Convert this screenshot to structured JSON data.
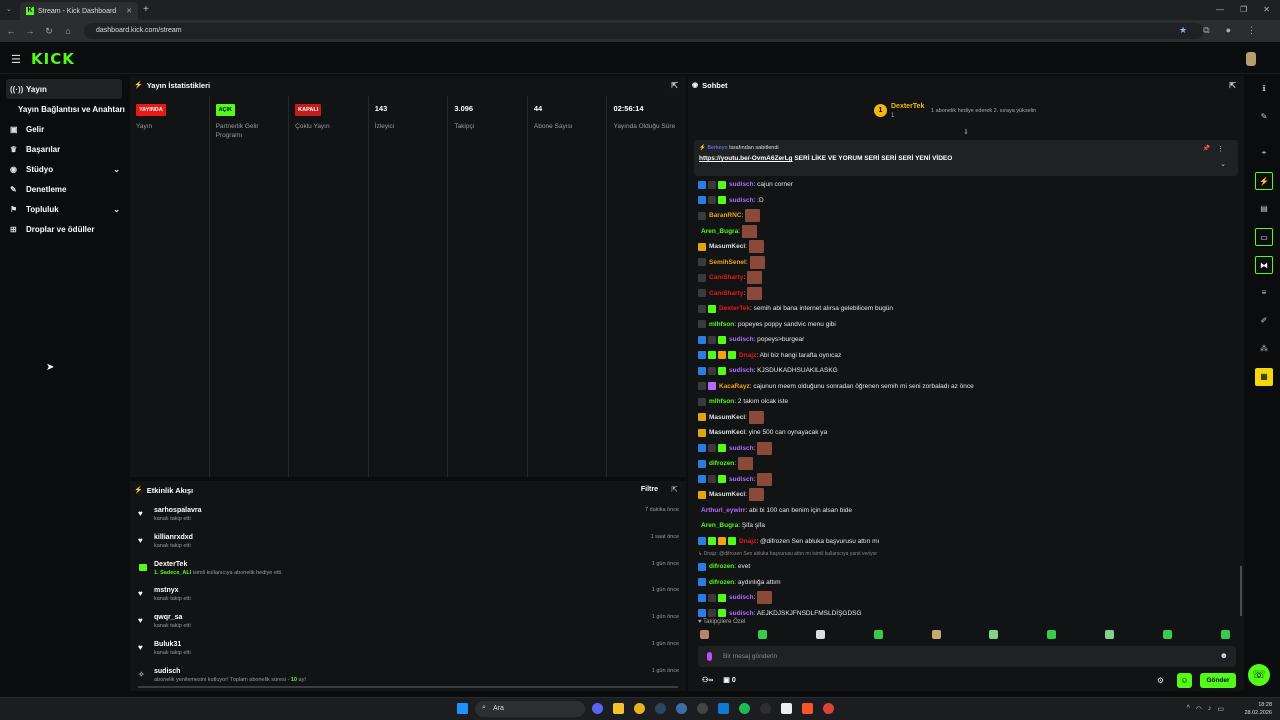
{
  "browser": {
    "tab_title": "Stream - Kick Dashboard",
    "url": "dashboard.kick.com/stream"
  },
  "brand": {
    "logo": "KICK",
    "accent": "#53fc18"
  },
  "sidebar": {
    "items": [
      {
        "label": "Yayın",
        "icon": "broadcast-icon",
        "active": true
      },
      {
        "label": "Yayın Bağlantısı ve Anahtarı",
        "sub": true
      },
      {
        "label": "Gelir",
        "icon": "wallet-icon"
      },
      {
        "label": "Başarılar",
        "icon": "trophy-icon"
      },
      {
        "label": "Stüdyo",
        "icon": "studio-icon",
        "chevron": true
      },
      {
        "label": "Denetleme",
        "icon": "wrench-icon"
      },
      {
        "label": "Topluluk",
        "icon": "community-icon",
        "chevron": true
      },
      {
        "label": "Droplar ve ödüller",
        "icon": "gift-icon"
      }
    ]
  },
  "stats": {
    "title": "Yayın İstatistikleri",
    "cols": [
      {
        "value": "YAYINDA",
        "label": "Yayın",
        "badge": "red"
      },
      {
        "value": "AÇIK",
        "label": "Partnerlik Gelir Programı",
        "badge": "green"
      },
      {
        "value": "KAPALI",
        "label": "Çoklu Yayın",
        "badge": "redd"
      },
      {
        "value": "143",
        "label": "İzleyici"
      },
      {
        "value": "3.096",
        "label": "Takipçi"
      },
      {
        "value": "44",
        "label": "Abone Sayısı"
      },
      {
        "value": "02:56:14",
        "label": "Yayında Olduğu Süre"
      }
    ]
  },
  "activity": {
    "title": "Etkinlik Akışı",
    "filter": "Filtre",
    "items": [
      {
        "name": "sarhospalavra",
        "desc": "kanalı takip etti",
        "time": "7 dakika önce",
        "icon": "heart-icon"
      },
      {
        "name": "killianrxdxd",
        "desc": "kanalı takip etti",
        "time": "1 saat önce",
        "icon": "heart-icon"
      },
      {
        "name": "DexterTek",
        "desc_highlight": "1. Sadece_ALI",
        "desc": " isimli kullanıcıya abonelik hediye etti.",
        "time": "1 gün önce",
        "icon": "gift-sub-icon"
      },
      {
        "name": "mstnyx",
        "desc": "kanalı takip etti",
        "time": "1 gün önce",
        "icon": "heart-icon"
      },
      {
        "name": "qwqr_sa",
        "desc": "kanalı takip etti",
        "time": "1 gün önce",
        "icon": "heart-icon"
      },
      {
        "name": "Buluk31",
        "desc": "kanalı takip etti",
        "time": "1 gün önce",
        "icon": "heart-icon"
      },
      {
        "name": "sudisch",
        "desc": "abonelik yenilemesini kutluyor! Toplam abonelik süresi - ",
        "desc_highlight2": "10",
        "desc_end": " ay!",
        "time": "1 gün önce",
        "icon": "sparkle-icon"
      }
    ]
  },
  "chat": {
    "title": "Sohbet",
    "gift_rank": "1",
    "gift_user": "DexterTek",
    "gift_count": "1",
    "gift_msg": "1 abonelik hediye ederek 2. sıraya yükselin",
    "pinned_by_user": "Berkeyo",
    "pinned_by_text": " tarafından sabitlendi",
    "pinned_link": "https://youtu.be/-OvmA6ZerLg",
    "pinned_text": " SERİ LİKE VE YORUM SERİ SERİ SERİ YENİ VİDEO",
    "messages": [
      {
        "user": "sudisch",
        "color": "#b36cff",
        "text": ": cajun corner",
        "icons": [
          "#2a7de1",
          "#3a3a3a",
          "#53fc18"
        ]
      },
      {
        "user": "sudisch",
        "color": "#b36cff",
        "text": ": :D",
        "icons": [
          "#2a7de1",
          "#3a3a3a",
          "#53fc18"
        ]
      },
      {
        "user": "BaranRNC",
        "color": "#f2a20c",
        "text": ":",
        "icons": [
          "#3a3a3a"
        ],
        "emote": true
      },
      {
        "user": "Aren_Bugra",
        "color": "#53fc18",
        "text": ":",
        "icons": [],
        "emote": true
      },
      {
        "user": "MasumKeci",
        "color": "#ddd",
        "text": ":",
        "icons": [
          "#e0a80c"
        ],
        "emote": true
      },
      {
        "user": "SemihSenel",
        "color": "#f2a20c",
        "text": ":",
        "icons": [
          "#3a3a3a"
        ],
        "emote": true
      },
      {
        "user": "CanıSharty",
        "color": "#e91916",
        "text": ":",
        "icons": [
          "#3a3a3a"
        ],
        "emote": true
      },
      {
        "user": "CanıSharty",
        "color": "#e91916",
        "text": ":",
        "icons": [
          "#3a3a3a"
        ],
        "emote": true
      },
      {
        "user": "DexterTek",
        "color": "#e91916",
        "text": ": semih abi bana internet alırsa gelebilicem bugün",
        "icons": [
          "#3a3a3a",
          "#53fc18"
        ]
      },
      {
        "user": "mlhfson",
        "color": "#53fc18",
        "text": ": popeyes poppy sandvic menu gibi",
        "icons": [
          "#3a3a3a"
        ]
      },
      {
        "user": "sudisch",
        "color": "#b36cff",
        "text": ": popeys>burgear",
        "icons": [
          "#2a7de1",
          "#3a3a3a",
          "#53fc18"
        ]
      },
      {
        "user": "Dnajz",
        "color": "#e91916",
        "text": ": Abi biz hangi tarafta oynıcaz",
        "icons": [
          "#2a7de1",
          "#53fc18",
          "#f2a20c",
          "#53fc18"
        ]
      },
      {
        "user": "sudisch",
        "color": "#b36cff",
        "text": ": KJSDUKADHSUAKILASKG",
        "icons": [
          "#2a7de1",
          "#3a3a3a",
          "#53fc18"
        ]
      },
      {
        "user": "KacaRayz",
        "color": "#f2a20c",
        "text": ": cajunun meem olduğunu sonradan öğrenen semih mi seni zorbaladı az önce",
        "icons": [
          "#3a3a3a",
          "#b36cff"
        ]
      },
      {
        "user": "mlhfson",
        "color": "#53fc18",
        "text": ": 2 takım olcak iste",
        "icons": [
          "#3a3a3a"
        ]
      },
      {
        "user": "MasumKeci",
        "color": "#ddd",
        "text": ":",
        "icons": [
          "#e0a80c"
        ],
        "emote": true
      },
      {
        "user": "MasumKeci",
        "color": "#ddd",
        "text": ": yine 500 can oynayacak ya",
        "icons": [
          "#e0a80c"
        ]
      },
      {
        "user": "sudisch",
        "color": "#b36cff",
        "text": ":",
        "icons": [
          "#2a7de1",
          "#3a3a3a",
          "#53fc18"
        ],
        "emote": true
      },
      {
        "user": "difrozen",
        "color": "#53fc18",
        "text": ":",
        "icons": [
          "#2a7de1"
        ],
        "emote": true
      },
      {
        "user": "sudisch",
        "color": "#b36cff",
        "text": ":",
        "icons": [
          "#2a7de1",
          "#3a3a3a",
          "#53fc18"
        ],
        "emote": true
      },
      {
        "user": "MasumKeci",
        "color": "#ddd",
        "text": ":",
        "icons": [
          "#e0a80c"
        ],
        "emote": true
      },
      {
        "user": "Arthurl_eywirr",
        "color": "#b36cff",
        "text": ": abi bi 100 can benim için alsan bide",
        "icons": []
      },
      {
        "user": "Aren_Bugra",
        "color": "#53fc18",
        "text": ": Şifa şifa",
        "icons": []
      },
      {
        "user": "Dnajz",
        "color": "#e91916",
        "text": ": @difrozen Sen abluka başvurusu attın mı",
        "icons": [
          "#2a7de1",
          "#53fc18",
          "#f2a20c",
          "#53fc18"
        ]
      },
      {
        "reply": "↳ Dnajz: @difrozen Sen abluka başvurusu attın mı isimli kullanıcıya yanıt veriyor"
      },
      {
        "user": "difrozen",
        "color": "#53fc18",
        "text": ": evet",
        "icons": [
          "#2a7de1"
        ]
      },
      {
        "user": "difrozen",
        "color": "#53fc18",
        "text": ": aydınlığa attım",
        "icons": [
          "#2a7de1"
        ]
      },
      {
        "user": "sudisch",
        "color": "#b36cff",
        "text": ":",
        "icons": [
          "#2a7de1",
          "#3a3a3a",
          "#53fc18"
        ],
        "emote": true
      },
      {
        "user": "sudisch",
        "color": "#b36cff",
        "text": ": AEJKDJSKJFNSDLFMSLDİŞGDSG",
        "icons": [
          "#2a7de1",
          "#3a3a3a",
          "#53fc18"
        ]
      }
    ],
    "follower_label": "Takipçilere Özel",
    "input_placeholder": "Bir mesaj gönderin",
    "points": "0",
    "send_label": "Gönder"
  },
  "taskbar": {
    "search": "Ara",
    "time": "18:28",
    "date": "28.02.2026"
  }
}
